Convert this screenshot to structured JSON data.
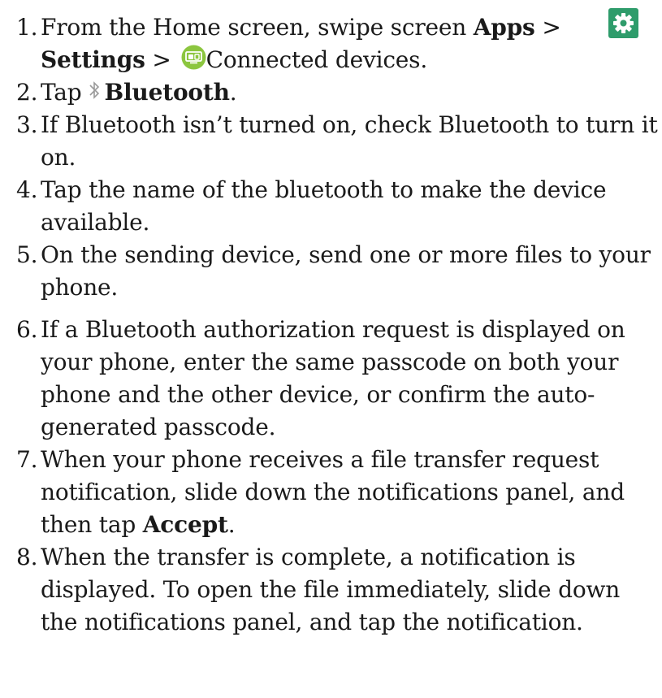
{
  "steps": [
    {
      "num": "1.",
      "a": "From the Home screen, swipe screen ",
      "b_apps": "Apps",
      "c": " >",
      "d_settings": "Settings",
      "e": " >",
      "f": "Connected devices."
    },
    {
      "num": "2.",
      "a": "Tap",
      "b_bold": "Bluetooth",
      "c": "."
    },
    {
      "num": "3.",
      "text": "If Bluetooth isn’t turned on, check Bluetooth to turn it on."
    },
    {
      "num": "4.",
      "text": "Tap the name of the bluetooth to make the device available."
    },
    {
      "num": "5.",
      "text": "On the sending device, send one or more files to your phone."
    },
    {
      "num": "6.",
      "text": "If a Bluetooth authorization request is displayed on your phone, enter the same passcode on both your phone and the other device, or confirm the auto-generated passcode."
    },
    {
      "num": "7.",
      "a": "When your phone receives a file transfer request notification, slide down the notifications panel, and then tap ",
      "b_bold": "Accept",
      "c": "."
    },
    {
      "num": "8.",
      "text": "When the transfer is complete, a notification is displayed. To open the file immediately, slide down the notifications panel, and tap the notification."
    }
  ],
  "icons": {
    "settings": "gear-icon",
    "connected_devices": "connected-devices-icon",
    "bluetooth": "bluetooth-icon"
  },
  "colors": {
    "settings_bg": "#2e9c6b",
    "connected_bg": "#8cc63f",
    "bluetooth_glyph": "#9a9a9a"
  }
}
